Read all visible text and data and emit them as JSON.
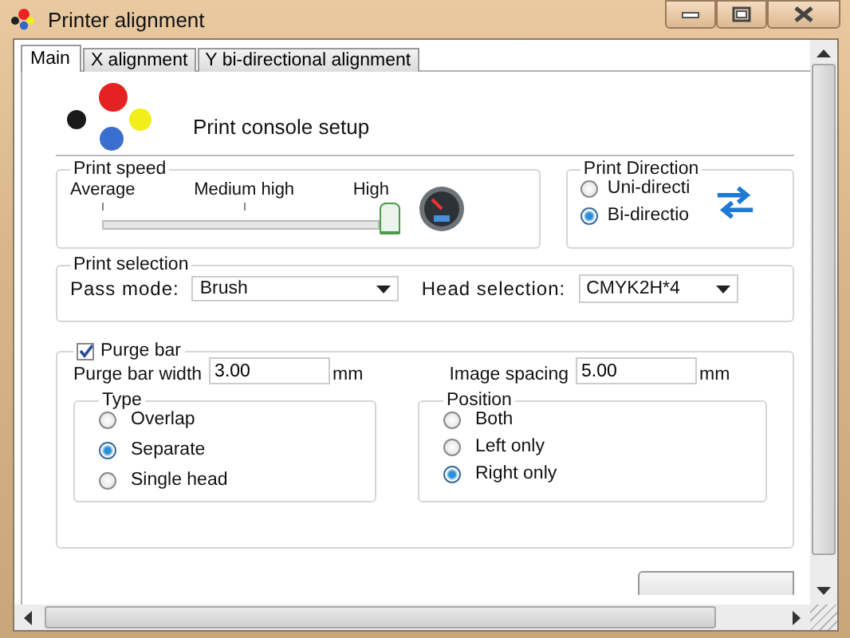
{
  "window": {
    "title": "Printer alignment"
  },
  "tabs": [
    {
      "label": "Main",
      "selected": true
    },
    {
      "label": "X alignment",
      "selected": false
    },
    {
      "label": "Y bi-directional alignment",
      "selected": false
    }
  ],
  "header": {
    "title": "Print console setup"
  },
  "print_speed": {
    "title": "Print speed",
    "ticks": [
      "Average",
      "Medium high",
      "High"
    ],
    "level": 1
  },
  "print_direction": {
    "title": "Print Direction",
    "options": [
      {
        "label": "Uni-directi",
        "selected": false
      },
      {
        "label": "Bi-directio",
        "selected": true
      }
    ]
  },
  "print_selection": {
    "title": "Print selection",
    "pass_mode": {
      "label": "Pass mode:",
      "value": "Brush"
    },
    "head_selection": {
      "label": "Head selection:",
      "value": "CMYK2H*4"
    }
  },
  "purge_bar": {
    "label": "Purge bar",
    "checked": true,
    "width": {
      "label": "Purge bar width",
      "value": "3.00",
      "unit": "mm"
    },
    "spacing": {
      "label": "Image spacing",
      "value": "5.00",
      "unit": "mm"
    },
    "type": {
      "title": "Type",
      "options": [
        {
          "label": "Overlap",
          "selected": false
        },
        {
          "label": "Separate",
          "selected": true
        },
        {
          "label": "Single head",
          "selected": false
        }
      ]
    },
    "position": {
      "title": "Position",
      "options": [
        {
          "label": "Both",
          "selected": false
        },
        {
          "label": "Left only",
          "selected": false
        },
        {
          "label": "Right only",
          "selected": true
        }
      ]
    }
  }
}
